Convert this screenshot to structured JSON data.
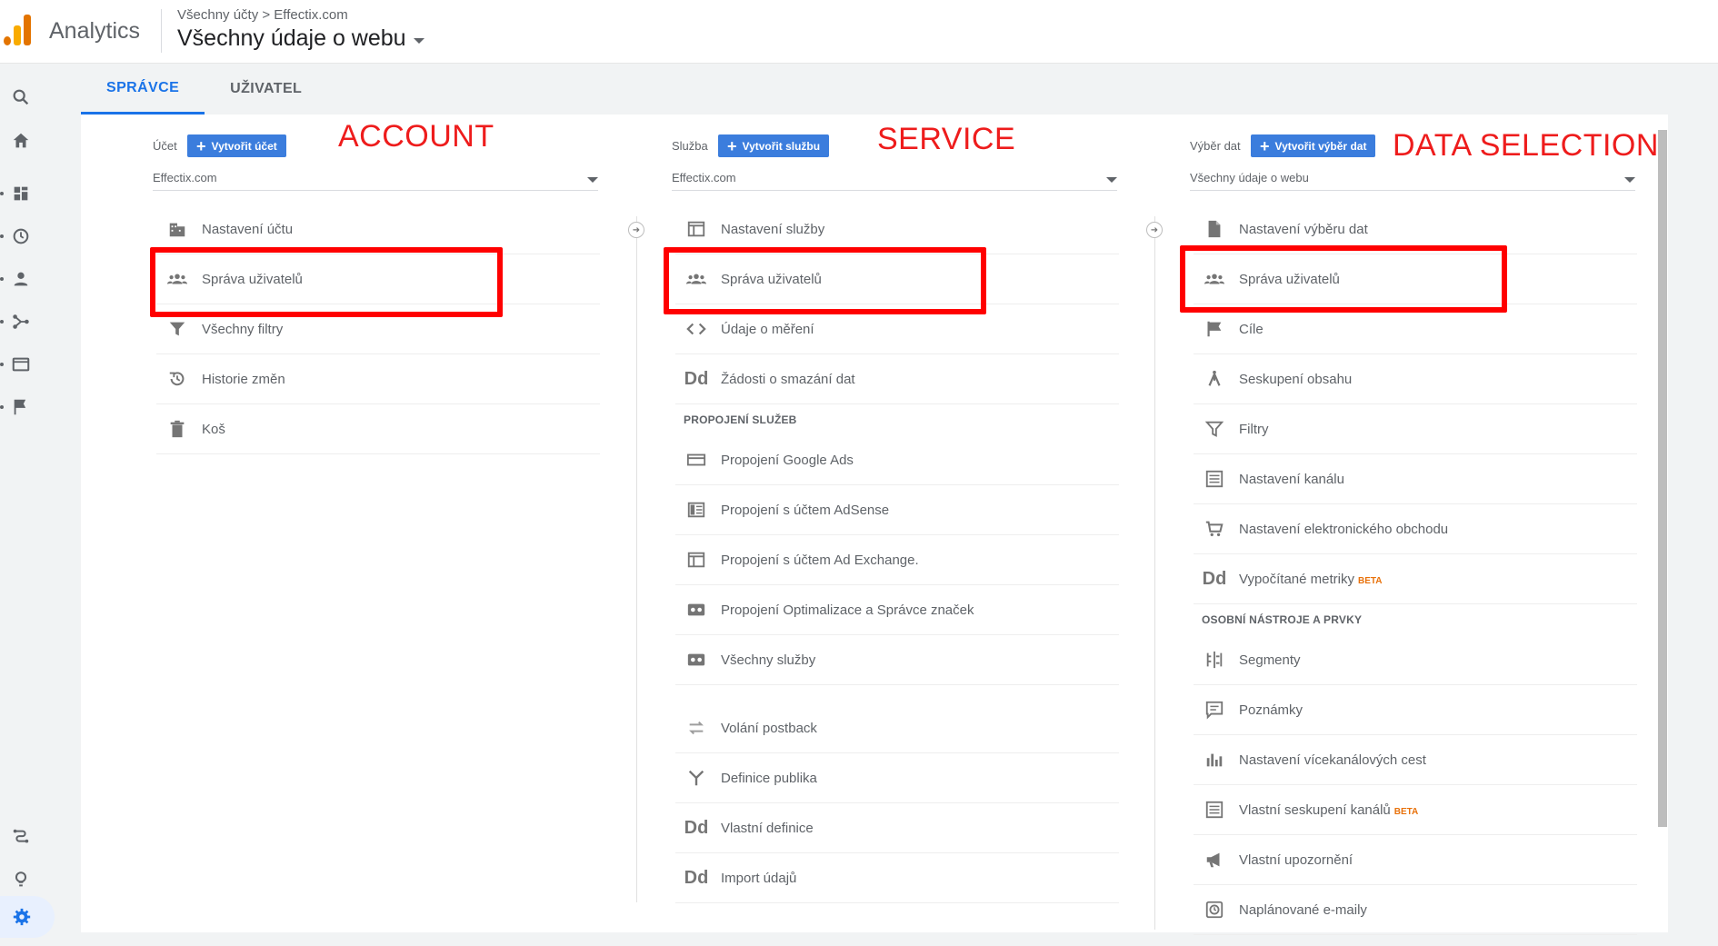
{
  "header": {
    "app_name": "Analytics",
    "breadcrumb": "Všechny účty > Effectix.com",
    "view_name": "Všechny údaje o webu"
  },
  "tabs": [
    {
      "label": "SPRÁVCE",
      "active": true
    },
    {
      "label": "UŽIVATEL",
      "active": false
    }
  ],
  "account": {
    "label": "Účet",
    "create_label": "Vytvořit účet",
    "selected": "Effectix.com",
    "items": [
      {
        "label": "Nastavení účtu",
        "icon": "building-icon"
      },
      {
        "label": "Správa uživatelů",
        "icon": "people-icon"
      },
      {
        "label": "Všechny filtry",
        "icon": "filter-icon"
      },
      {
        "label": "Historie změn",
        "icon": "history-icon"
      },
      {
        "label": "Koš",
        "icon": "trash-icon"
      }
    ]
  },
  "property": {
    "label": "Služba",
    "create_label": "Vytvořit službu",
    "selected": "Effectix.com",
    "items": [
      {
        "label": "Nastavení služby",
        "icon": "window-icon"
      },
      {
        "label": "Správa uživatelů",
        "icon": "people-icon"
      },
      {
        "label": "Údaje o měření",
        "icon": "code-icon"
      },
      {
        "label": "Žádosti o smazání dat",
        "icon": "dd-icon"
      }
    ],
    "section_title": "PROPOJENÍ SLUŽEB",
    "links": [
      {
        "label": "Propojení Google Ads",
        "icon": "ads-icon"
      },
      {
        "label": "Propojení s účtem AdSense",
        "icon": "adsense-icon"
      },
      {
        "label": "Propojení s účtem Ad Exchange.",
        "icon": "window-icon"
      },
      {
        "label": "Propojení Optimalizace a Správce značek",
        "icon": "optimize-icon"
      },
      {
        "label": "Všechny služby",
        "icon": "products-icon"
      }
    ],
    "more": [
      {
        "label": "Volání postback",
        "icon": "postback-icon"
      },
      {
        "label": "Definice publika",
        "icon": "audience-icon"
      },
      {
        "label": "Vlastní definice",
        "icon": "dd-icon"
      },
      {
        "label": "Import údajů",
        "icon": "dd-icon"
      }
    ]
  },
  "view": {
    "label": "Výběr dat",
    "create_label": "Vytvořit výběr dat",
    "selected": "Všechny údaje o webu",
    "items": [
      {
        "label": "Nastavení výběru dat",
        "icon": "document-icon"
      },
      {
        "label": "Správa uživatelů",
        "icon": "people-icon"
      },
      {
        "label": "Cíle",
        "icon": "flag-icon"
      },
      {
        "label": "Seskupení obsahu",
        "icon": "content-group-icon"
      },
      {
        "label": "Filtry",
        "icon": "filter-icon"
      },
      {
        "label": "Nastavení kanálu",
        "icon": "channel-icon"
      },
      {
        "label": "Nastavení elektronického obchodu",
        "icon": "cart-icon"
      },
      {
        "label": "Vypočítané metriky",
        "icon": "dd-icon",
        "badge": "BETA"
      }
    ],
    "section_title": "OSOBNÍ NÁSTROJE A PRVKY",
    "tools": [
      {
        "label": "Segmenty",
        "icon": "segments-icon"
      },
      {
        "label": "Poznámky",
        "icon": "comment-icon"
      },
      {
        "label": "Nastavení vícekanálových cest",
        "icon": "bar-chart-icon"
      },
      {
        "label": "Vlastní seskupení kanálů",
        "icon": "channel-icon",
        "badge": "BETA"
      },
      {
        "label": "Vlastní upozornění",
        "icon": "megaphone-icon"
      },
      {
        "label": "Naplánované e-maily",
        "icon": "schedule-icon"
      }
    ]
  },
  "annotations": {
    "account": "ACCOUNT",
    "service": "SERVICE",
    "data_selection": "DATA SELECTION"
  },
  "colors": {
    "accent": "#1a73e8",
    "button": "#3b7ddd",
    "annotation": "#ff0000"
  }
}
